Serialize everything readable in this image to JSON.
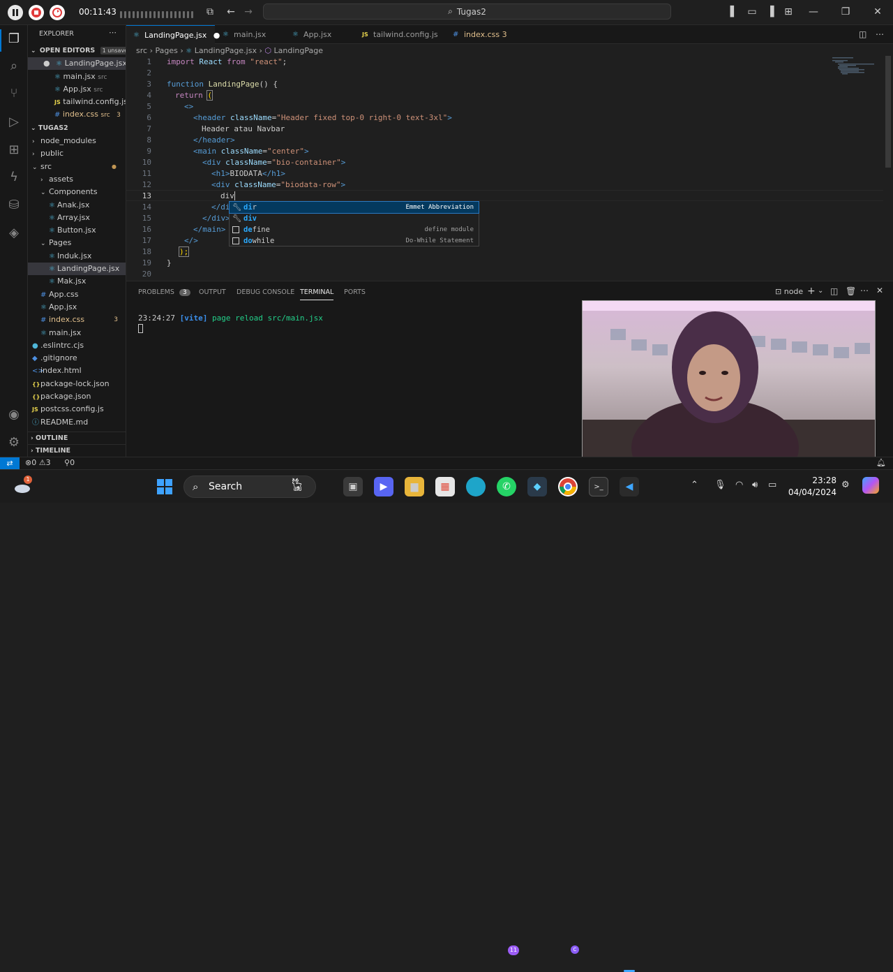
{
  "recorder": {
    "timer": "00:11:43"
  },
  "window": {
    "command_center": "Tugas2"
  },
  "sidebar": {
    "explorer_label": "EXPLORER",
    "open_editors_label": "OPEN EDITORS",
    "unsaved_badge": "1 unsaved",
    "open_editors": [
      {
        "name": "LandingPage.jsx...",
        "path": "",
        "badge": ""
      },
      {
        "name": "main.jsx",
        "path": "src",
        "badge": ""
      },
      {
        "name": "App.jsx",
        "path": "src",
        "badge": ""
      },
      {
        "name": "tailwind.config.js",
        "path": "",
        "badge": ""
      },
      {
        "name": "index.css",
        "path": "src",
        "badge": "3"
      }
    ],
    "project_label": "TUGAS2",
    "tree": [
      {
        "name": "node_modules"
      },
      {
        "name": "public"
      },
      {
        "name": "src"
      },
      {
        "name": "assets"
      },
      {
        "name": "Components"
      },
      {
        "name": "Anak.jsx"
      },
      {
        "name": "Array.jsx"
      },
      {
        "name": "Button.jsx"
      },
      {
        "name": "Pages"
      },
      {
        "name": "Induk.jsx"
      },
      {
        "name": "LandingPage.jsx"
      },
      {
        "name": "Mak.jsx"
      },
      {
        "name": "App.css"
      },
      {
        "name": "App.jsx"
      },
      {
        "name": "index.css",
        "badge": "3"
      },
      {
        "name": "main.jsx"
      },
      {
        "name": ".eslintrc.cjs"
      },
      {
        "name": ".gitignore"
      },
      {
        "name": "index.html"
      },
      {
        "name": "package-lock.json"
      },
      {
        "name": "package.json"
      },
      {
        "name": "postcss.config.js"
      },
      {
        "name": "README.md"
      }
    ],
    "outline_label": "OUTLINE",
    "timeline_label": "TIMELINE"
  },
  "tabs": [
    {
      "label": "LandingPage.jsx",
      "badge": ""
    },
    {
      "label": "main.jsx",
      "badge": ""
    },
    {
      "label": "App.jsx",
      "badge": ""
    },
    {
      "label": "tailwind.config.js",
      "badge": ""
    },
    {
      "label": "index.css",
      "badge": "3"
    }
  ],
  "breadcrumb": {
    "a": "src",
    "b": "Pages",
    "c": "LandingPage.jsx",
    "d": "LandingPage"
  },
  "editor": {
    "line_numbers": [
      "1",
      "2",
      "3",
      "4",
      "5",
      "6",
      "7",
      "8",
      "9",
      "10",
      "11",
      "12",
      "13",
      "14",
      "15",
      "16",
      "17",
      "18",
      "19",
      "20"
    ],
    "l1": {
      "kw": "import",
      "id": "React",
      "from": "from",
      "str": "\"react\"",
      "semi": ";"
    },
    "l3": {
      "kw": "function",
      "fn": "LandingPage",
      "rest": "() {"
    },
    "l4": {
      "kw": "return",
      "paren": "("
    },
    "l5": {
      "t": "<>"
    },
    "l6": {
      "open": "<header",
      "attr": "className",
      "eq": "=",
      "val": "\"Header fixed top-0 right-0 text-3xl\"",
      "close": ">"
    },
    "l7": {
      "t": "Header atau Navbar"
    },
    "l8": {
      "t": "</header>"
    },
    "l9": {
      "open": "<main",
      "attr": "className",
      "eq": "=",
      "val": "\"center\"",
      "close": ">"
    },
    "l10": {
      "open": "<div",
      "attr": "className",
      "eq": "=",
      "val": "\"bio-container\"",
      "close": ">"
    },
    "l11": {
      "open": "<h1>",
      "txt": "BIODATA",
      "close": "</h1>"
    },
    "l12": {
      "open": "<div",
      "attr": "className",
      "eq": "=",
      "val": "\"biodata-row\"",
      "close": ">"
    },
    "l13": {
      "t": "div"
    },
    "l14": {
      "t": "</di"
    },
    "l15": {
      "t": "</div>"
    },
    "l16": {
      "t": "</main>"
    },
    "l17": {
      "t": "</>"
    },
    "l18": {
      "t": ");"
    },
    "l19": {
      "t": "}"
    }
  },
  "suggest": [
    {
      "pre": "di",
      "post": "r",
      "detail": "Emmet Abbreviation"
    },
    {
      "pre": "div",
      "post": "",
      "detail": ""
    },
    {
      "pre": "de",
      "post": "fine",
      "detail": "define module"
    },
    {
      "pre": "do",
      "post": "while",
      "detail": "Do-While Statement"
    }
  ],
  "panel": {
    "tabs": [
      "PROBLEMS",
      "OUTPUT",
      "DEBUG CONSOLE",
      "TERMINAL",
      "PORTS"
    ],
    "problems_count": "3",
    "shell": "node",
    "terminal_time": "23:24:27",
    "terminal_tag": "[vite]",
    "terminal_msg": "page reload src/main.jsx"
  },
  "statusbar": {
    "errors": "0",
    "warnings": "3",
    "ports": "0"
  },
  "taskbar": {
    "search": "Search",
    "time": "23:28",
    "date": "04/04/2024",
    "weather_badge": "1",
    "whatsapp_badge": "11",
    "chrome_badge": "C"
  },
  "colors": {
    "accent": "#0078d4",
    "status_remote": "#0078d4",
    "keyword": "#569cd6",
    "string": "#ce9178",
    "attr": "#9cdcfe"
  }
}
